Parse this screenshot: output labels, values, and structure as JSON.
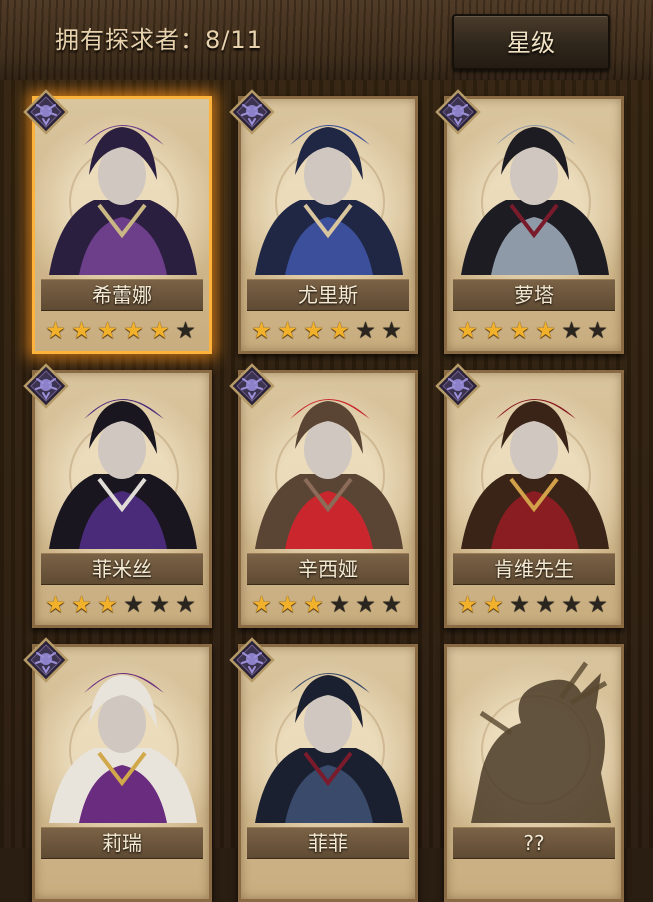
{
  "header": {
    "owned_label": "拥有探求者：8/11",
    "filter_button": "星级"
  },
  "cards": [
    {
      "name": "希蕾娜",
      "stars": 5,
      "max_stars": 6,
      "selected": true,
      "locked": false,
      "palette": [
        "#2b1f3f",
        "#6d3e8a",
        "#c9b784"
      ]
    },
    {
      "name": "尤里斯",
      "stars": 4,
      "max_stars": 6,
      "selected": false,
      "locked": false,
      "palette": [
        "#1f2745",
        "#3b4f9a",
        "#d9c59e"
      ]
    },
    {
      "name": "萝塔",
      "stars": 4,
      "max_stars": 6,
      "selected": false,
      "locked": false,
      "palette": [
        "#1d1c22",
        "#8f9aa8",
        "#7a1b2c"
      ]
    },
    {
      "name": "菲米丝",
      "stars": 3,
      "max_stars": 6,
      "selected": false,
      "locked": false,
      "palette": [
        "#1a1620",
        "#4a2b7a",
        "#e0dcd6"
      ]
    },
    {
      "name": "辛西娅",
      "stars": 3,
      "max_stars": 6,
      "selected": false,
      "locked": false,
      "palette": [
        "#5a4434",
        "#c9272d",
        "#8a6c58"
      ]
    },
    {
      "name": "肯维先生",
      "stars": 2,
      "max_stars": 6,
      "selected": false,
      "locked": false,
      "palette": [
        "#3a2418",
        "#8a1d22",
        "#d2a14a"
      ]
    },
    {
      "name": "莉瑞",
      "stars": 0,
      "max_stars": 6,
      "selected": false,
      "locked": false,
      "palette": [
        "#e8e4dc",
        "#6a2c7e",
        "#d1a84a"
      ]
    },
    {
      "name": "菲菲",
      "stars": 0,
      "max_stars": 6,
      "selected": false,
      "locked": false,
      "palette": [
        "#1b2030",
        "#3a4a6a",
        "#7a1b2c"
      ]
    },
    {
      "name": "??",
      "stars": 0,
      "max_stars": 6,
      "selected": false,
      "locked": true,
      "palette": [
        "#4a3b28",
        "#5a4930",
        "#cbb48a"
      ]
    }
  ]
}
